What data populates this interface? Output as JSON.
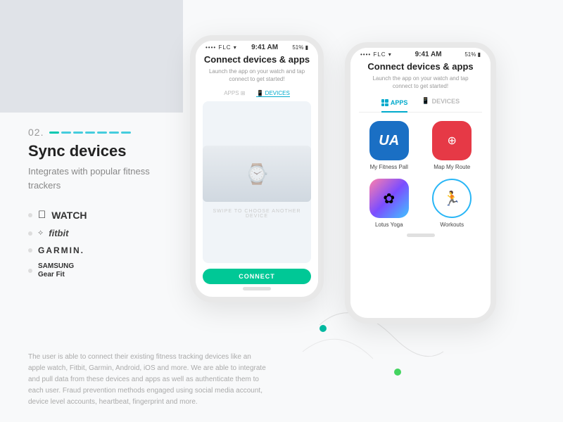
{
  "page": {
    "bg_rect": "gray rectangle top left",
    "step_number": "02.",
    "step_dots_count": 7,
    "section_title": "Sync devices",
    "section_desc": "Integrates with popular fitness trackers",
    "brands": [
      {
        "name": "WATCH",
        "prefix": "apple",
        "label": " WATCH"
      },
      {
        "name": "fitbit",
        "prefix": "fitbit",
        "label": "fitbit"
      },
      {
        "name": "GARMIN",
        "prefix": "garmin",
        "label": "GARMIN."
      },
      {
        "name": "Samsung Gear Fit",
        "prefix": "samsung",
        "label": "Samsung\nGear Fit"
      }
    ],
    "bottom_text": "The user is able to connect their existing fitness tracking devices like an apple watch, Fitbit, Garmin, Android, iOS and more. We are able to integrate and pull data from these devices and apps as well as authenticate them to each user. Fraud prevention methods engaged using social media account, device level accounts, heartbeat, fingerprint and more.",
    "phone_left": {
      "status": {
        "signal": "•••• FLC",
        "time": "9:41 AM",
        "battery": "51%"
      },
      "title": "Connect devices & apps",
      "subtitle": "Launch the app on your watch and tap\nconnect to get started!",
      "tabs": [
        {
          "label": "APPS",
          "active": false
        },
        {
          "label": "DEVICES",
          "active": true
        }
      ],
      "swipe_hint": "SWIPE TO CHOOSE ANOTHER DEVICE",
      "connect_btn": "CONNECT"
    },
    "phone_right": {
      "status": {
        "signal": "•••• FLC",
        "time": "9:41 AM",
        "battery": "51%"
      },
      "title": "Connect devices & apps",
      "subtitle": "Launch the app on your watch and tap\nconnect to get started!",
      "tabs": [
        {
          "label": "APPS",
          "active": true
        },
        {
          "label": "DEVICES",
          "active": false
        }
      ],
      "apps": [
        {
          "name": "My Fitness Pall",
          "icon_type": "blue",
          "icon_text": "UA"
        },
        {
          "name": "Map My Route",
          "icon_type": "red",
          "icon_text": "⊕"
        },
        {
          "name": "Lotus Yoga",
          "icon_type": "gradient",
          "icon_text": "✿"
        },
        {
          "name": "Workouts",
          "icon_type": "circle",
          "icon_text": "🏃"
        }
      ]
    }
  }
}
